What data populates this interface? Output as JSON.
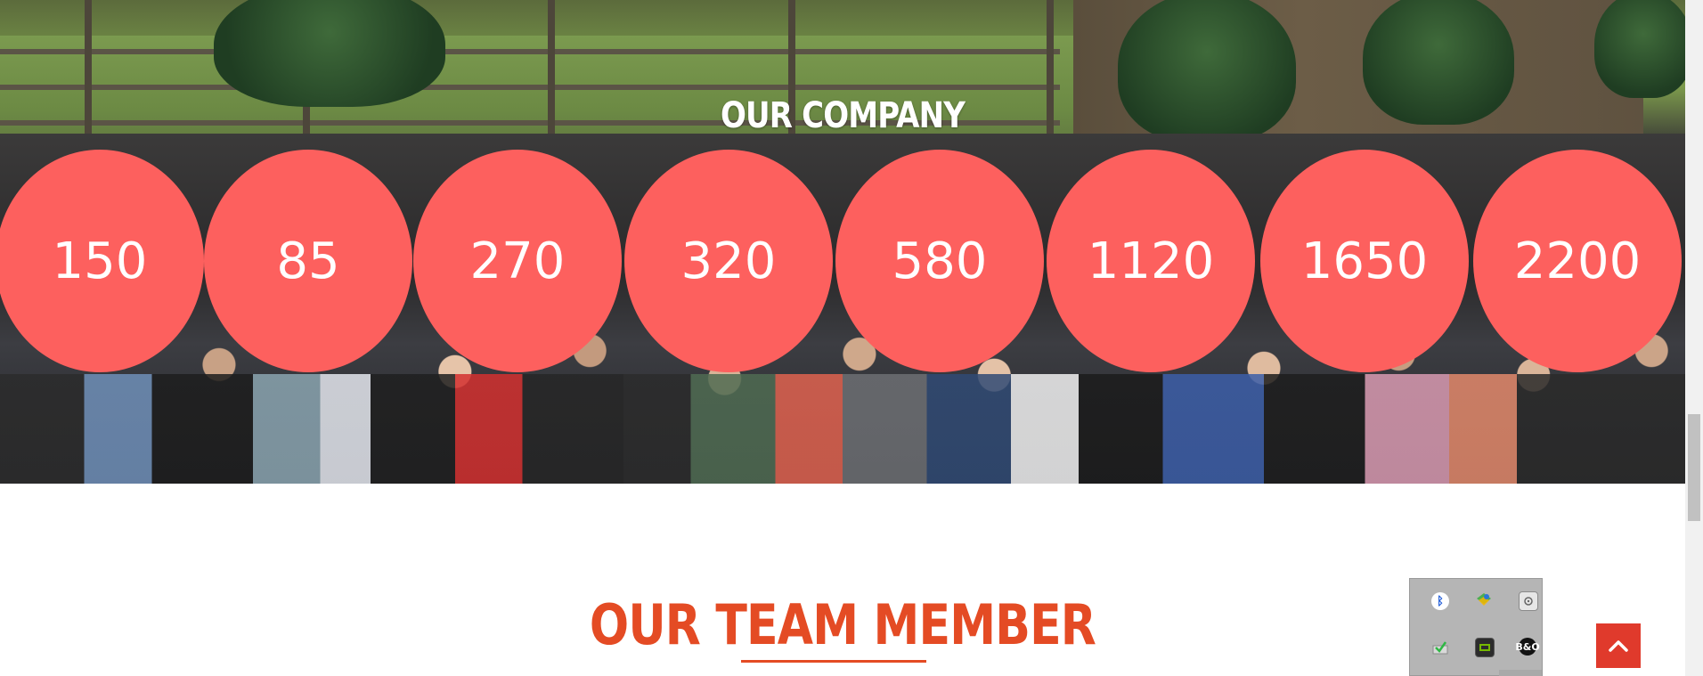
{
  "hero": {
    "title": "OUR COMPANY",
    "stats": [
      {
        "value": "150"
      },
      {
        "value": "85"
      },
      {
        "value": "270"
      },
      {
        "value": "320"
      },
      {
        "value": "580"
      },
      {
        "value": "1120"
      },
      {
        "value": "1650"
      },
      {
        "value": "2200"
      }
    ]
  },
  "team": {
    "title": "OUR TEAM MEMBER"
  },
  "colors": {
    "circle": "#fd605e",
    "accent": "#e44b24",
    "back_to_top": "#e03a2c"
  },
  "tray": {
    "icons": [
      "bluetooth-icon",
      "network-icon",
      "drive-icon",
      "checkmark-icon",
      "gpu-icon",
      "bang-olufsen-icon"
    ]
  },
  "back_to_top": {
    "icon": "chevron-up-icon"
  }
}
